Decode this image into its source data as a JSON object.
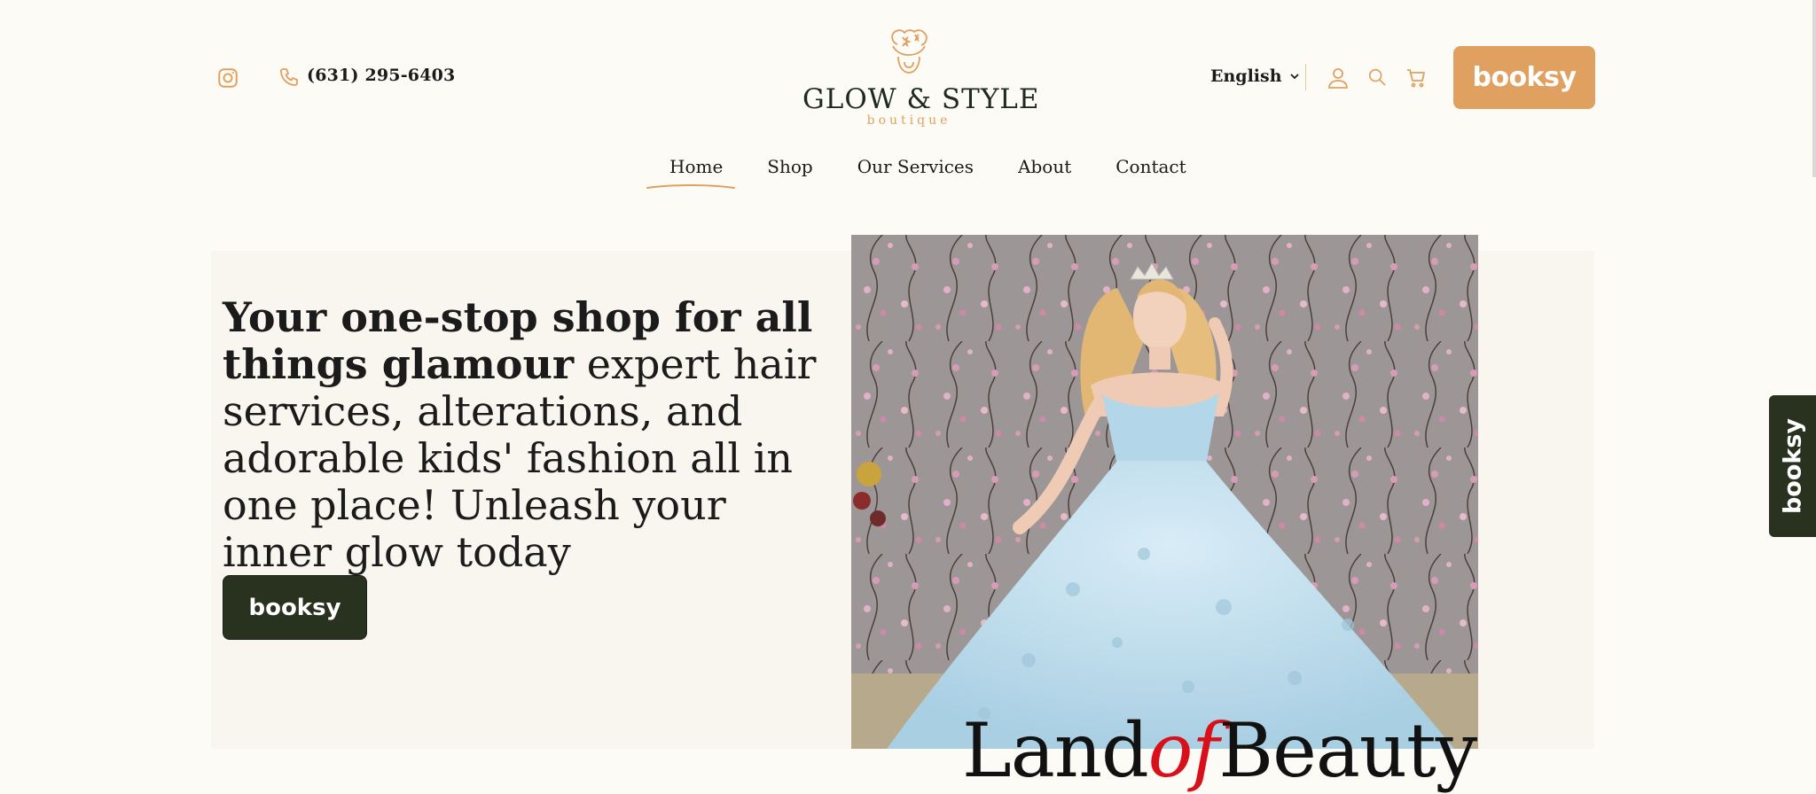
{
  "header": {
    "phone": "(631) 295-6403",
    "logo_name": "GLOW & STYLE",
    "logo_sub": "boutique",
    "language": "English",
    "booking_button": "booksy"
  },
  "nav": {
    "items": [
      "Home",
      "Shop",
      "Our Services",
      "About",
      "Contact"
    ],
    "active": "Home"
  },
  "hero": {
    "heading_bold": "Your one-stop shop for all things glamour",
    "heading_rest": " expert hair services, alterations, and adorable kids' fashion all in one place! Unleash your inner glow today",
    "booking_button": "booksy",
    "image_overlay_left": "Land",
    "image_overlay_mid": "of",
    "image_overlay_right": "Beauty"
  },
  "side_tab": {
    "label": "booksy"
  },
  "colors": {
    "accent": "#e0a060",
    "dark_green": "#29321f",
    "background": "#fcfbf6"
  },
  "icons": [
    "instagram-icon",
    "phone-icon",
    "chevron-down-icon",
    "user-icon",
    "search-icon",
    "cart-icon"
  ]
}
